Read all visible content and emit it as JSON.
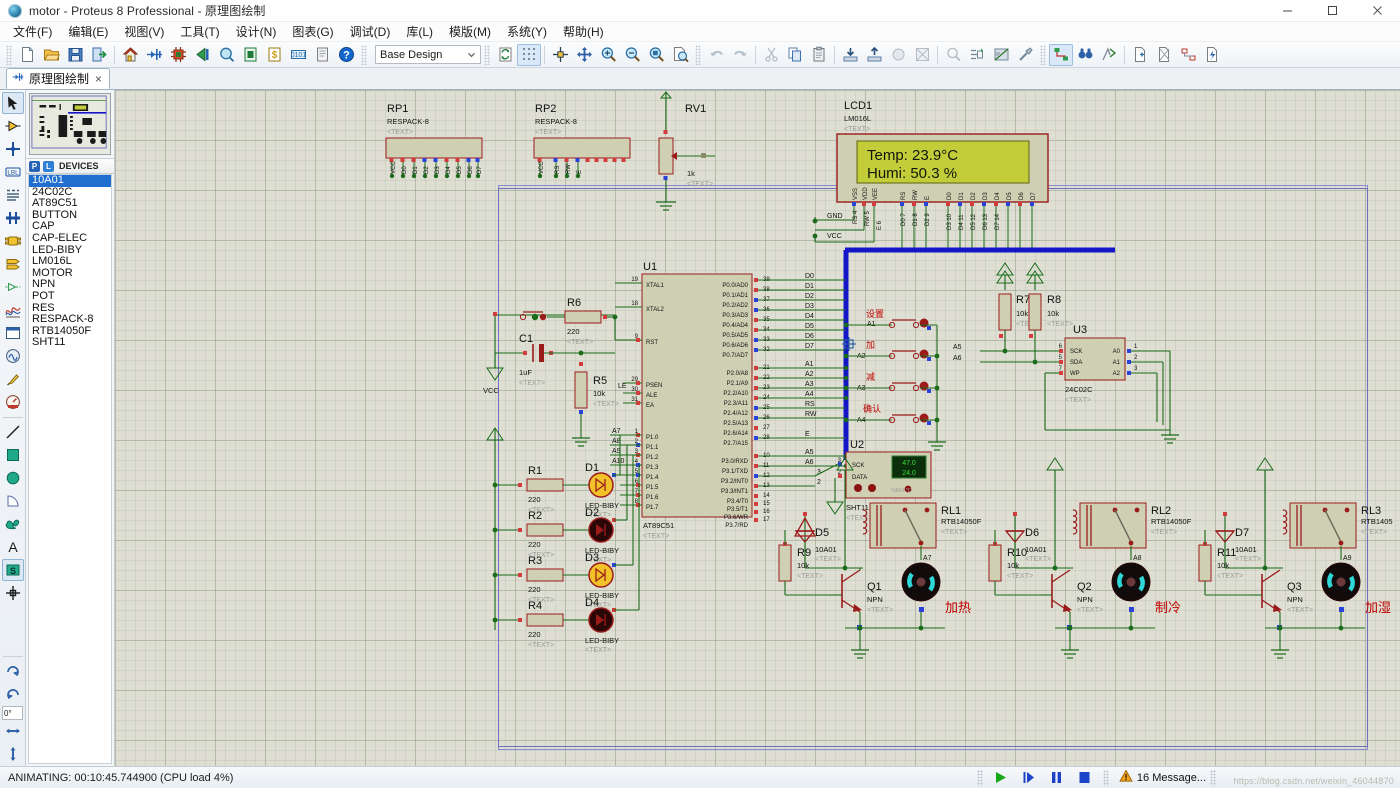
{
  "window": {
    "title": "motor - Proteus 8 Professional - 原理图绘制",
    "app_icon": "proteus-orb-icon",
    "minimize_label": "最小化",
    "maximize_label": "最大化",
    "close_label": "关闭"
  },
  "menubar": {
    "items": [
      {
        "name": "file",
        "label": "文件(F)"
      },
      {
        "name": "edit",
        "label": "编辑(E)"
      },
      {
        "name": "view",
        "label": "视图(V)"
      },
      {
        "name": "tools",
        "label": "工具(T)"
      },
      {
        "name": "design",
        "label": "设计(N)"
      },
      {
        "name": "graph",
        "label": "图表(G)"
      },
      {
        "name": "debug",
        "label": "调试(D)"
      },
      {
        "name": "library",
        "label": "库(L)"
      },
      {
        "name": "template",
        "label": "模版(M)"
      },
      {
        "name": "system",
        "label": "系统(Y)"
      },
      {
        "name": "help",
        "label": "帮助(H)"
      }
    ]
  },
  "toolbar": {
    "design_selector_value": "Base Design",
    "groups": [
      [
        "new-file-icon",
        "open-folder-icon",
        "save-icon",
        "export-icon"
      ],
      [
        "home-icon",
        "schematic-capture-icon",
        "pcb-layout-icon",
        "3d-viewer-icon",
        "design-explorer-icon",
        "bom-report-icon",
        "bill-of-materials-icon",
        "visual-designer-icon",
        "source-code-icon",
        "help-icon"
      ]
    ],
    "view_group": [
      "refresh-icon",
      "toggle-grid-icon",
      "origin-icon",
      "pan-icon",
      "zoom-in-icon",
      "zoom-out-icon",
      "zoom-area-icon",
      "zoom-sheet-icon"
    ],
    "edit_group": [
      "undo-icon",
      "redo-icon",
      "cut-icon",
      "copy-icon",
      "paste-icon",
      "block-copy-icon",
      "block-move-icon",
      "block-rotate-icon",
      "block-delete-icon"
    ],
    "tool_group": [
      "pick-device-icon",
      "make-device-icon",
      "packaging-tool-icon",
      "decompose-icon"
    ],
    "net_group": [
      "wire-autorouter-icon",
      "search-tag-icon",
      "property-assign-icon",
      "new-sheet-icon",
      "remove-sheet-icon",
      "exit-sheet-icon",
      "bom-icon",
      "electrical-rules-icon"
    ]
  },
  "document_tab": {
    "icon": "schematic-icon",
    "label": "原理图绘制",
    "close_label": "×"
  },
  "left_toolbar": {
    "items": [
      {
        "name": "selection-mode",
        "icon": "arrow-cursor-icon",
        "selected": true
      },
      {
        "name": "component-mode",
        "icon": "component-icon",
        "selected": false
      },
      {
        "name": "junction-dot-mode",
        "icon": "junction-dot-icon",
        "selected": false
      },
      {
        "name": "wire-label-mode",
        "icon": "label-icon",
        "selected": false
      },
      {
        "name": "text-script-mode",
        "icon": "text-script-icon",
        "selected": false
      },
      {
        "name": "bus-mode",
        "icon": "bus-icon",
        "selected": false
      },
      {
        "name": "subcircuit-mode",
        "icon": "subcircuit-icon",
        "selected": false
      },
      {
        "name": "terminal-mode",
        "icon": "terminal-icon",
        "selected": false
      },
      {
        "name": "device-pin-mode",
        "icon": "device-pin-icon",
        "selected": false
      },
      {
        "name": "graph-mode",
        "icon": "graph-icon",
        "selected": false
      },
      {
        "name": "tape-recorder-mode",
        "icon": "tape-recorder-icon",
        "selected": false
      },
      {
        "name": "generator-mode",
        "icon": "generator-icon",
        "selected": false
      },
      {
        "name": "voltage-probe-mode",
        "icon": "probe-icon",
        "selected": false
      },
      {
        "name": "virtual-instrument-mode",
        "icon": "instrument-icon",
        "selected": false
      },
      {
        "name": "2d-line-mode",
        "icon": "line-icon",
        "selected": false
      },
      {
        "name": "2d-box-mode",
        "icon": "box-icon",
        "selected": false
      },
      {
        "name": "2d-circle-mode",
        "icon": "circle-icon",
        "selected": false
      },
      {
        "name": "2d-arc-mode",
        "icon": "arc-icon",
        "selected": false
      },
      {
        "name": "2d-path-mode",
        "icon": "path-icon",
        "selected": false
      },
      {
        "name": "2d-text-mode",
        "icon": "text-icon",
        "selected": false
      },
      {
        "name": "symbol-mode",
        "icon": "symbol-icon",
        "selected": true
      },
      {
        "name": "marker-mode",
        "icon": "marker-icon",
        "selected": false
      }
    ],
    "rotate_cw": "rotate-clockwise-icon",
    "rotate_ccw": "rotate-counter-clockwise-icon",
    "rotation_value": "0°",
    "mirror_x": "mirror-horizontal-icon",
    "mirror_y": "mirror-vertical-icon"
  },
  "devices_panel": {
    "overview_label": "schematic-overview",
    "p_button": "P",
    "l_button": "L",
    "caption": "DEVICES",
    "items": [
      "10A01",
      "24C02C",
      "AT89C51",
      "BUTTON",
      "CAP",
      "CAP-ELEC",
      "LED-BIBY",
      "LM016L",
      "MOTOR",
      "NPN",
      "POT",
      "RES",
      "RESPACK-8",
      "RTB14050F",
      "SHT11"
    ],
    "selected_index": 0
  },
  "statusbar": {
    "message": "ANIMATING: 00:10:45.744900 (CPU load 4%)",
    "controls": [
      {
        "name": "play-button",
        "icon": "play-icon"
      },
      {
        "name": "step-button",
        "icon": "step-icon"
      },
      {
        "name": "pause-button",
        "icon": "pause-icon"
      },
      {
        "name": "stop-button",
        "icon": "stop-icon"
      }
    ],
    "warning_icon": "warning-triangle-icon",
    "messages_text": "16 Message...",
    "watermark": "https://blog.csdn.net/weixin_46044870"
  },
  "schematic": {
    "lcd": {
      "ref": "LCD1",
      "part": "LM016L",
      "text_tag": "<TEXT>",
      "line1": "Temp: 23.9°C",
      "line2": "Humi: 50.3 %",
      "screen_color": "#c3cd3a",
      "pins_top": [
        "VSS",
        "VDD",
        "VEE",
        "RS",
        "RW",
        "E",
        "D0",
        "D1",
        "D2",
        "D3",
        "D4",
        "D5",
        "D6",
        "D7"
      ],
      "pins_num": [
        "1",
        "2",
        "3",
        "4",
        "5",
        "6",
        "7",
        "8",
        "9",
        "10",
        "11",
        "12",
        "13",
        "14"
      ],
      "net_gnd": "GND",
      "net_vcc": "VCC"
    },
    "mcu": {
      "ref": "U1",
      "part": "AT89C51",
      "text_tag": "<TEXT>",
      "left_pins": [
        {
          "num": "19",
          "label": "XTAL1"
        },
        {
          "num": "18",
          "label": "XTAL2"
        },
        {
          "num": "9",
          "label": "RST"
        },
        {
          "num": "29",
          "label": "PSEN"
        },
        {
          "num": "30",
          "label": "ALE"
        },
        {
          "num": "31",
          "label": "EA"
        },
        {
          "num": "1",
          "label": "P1.0"
        },
        {
          "num": "2",
          "label": "P1.1"
        },
        {
          "num": "3",
          "label": "P1.2"
        },
        {
          "num": "4",
          "label": "P1.3"
        },
        {
          "num": "5",
          "label": "P1.4"
        },
        {
          "num": "6",
          "label": "P1.5"
        },
        {
          "num": "7",
          "label": "P1.6"
        },
        {
          "num": "8",
          "label": "P1.7"
        }
      ],
      "right_pins": [
        {
          "num": "39",
          "label": "P0.0/AD0",
          "net": "D0"
        },
        {
          "num": "38",
          "label": "P0.1/AD1",
          "net": "D1"
        },
        {
          "num": "37",
          "label": "P0.2/AD2",
          "net": "D2"
        },
        {
          "num": "36",
          "label": "P0.3/AD3",
          "net": "D3"
        },
        {
          "num": "35",
          "label": "P0.4/AD4",
          "net": "D4"
        },
        {
          "num": "34",
          "label": "P0.5/AD5",
          "net": "D5"
        },
        {
          "num": "33",
          "label": "P0.6/AD6",
          "net": "D6"
        },
        {
          "num": "32",
          "label": "P0.7/AD7",
          "net": "D7"
        },
        {
          "num": "21",
          "label": "P2.0/A8",
          "net": "A1"
        },
        {
          "num": "22",
          "label": "P2.1/A9",
          "net": "A2"
        },
        {
          "num": "23",
          "label": "P2.2/A10",
          "net": "A3"
        },
        {
          "num": "24",
          "label": "P2.3/A11",
          "net": "A4"
        },
        {
          "num": "25",
          "label": "P2.4/A12",
          "net": "RS"
        },
        {
          "num": "26",
          "label": "P2.5/A13",
          "net": "RW"
        },
        {
          "num": "27",
          "label": "P2.6/A14",
          "net": ""
        },
        {
          "num": "28",
          "label": "P2.7/A15",
          "net": "E"
        },
        {
          "num": "10",
          "label": "P3.0/RXD",
          "net": "A5"
        },
        {
          "num": "11",
          "label": "P3.1/TXD",
          "net": "A6"
        },
        {
          "num": "12",
          "label": "P3.2/INT0",
          "net": "3"
        },
        {
          "num": "13",
          "label": "P3.3/INT1",
          "net": "2"
        },
        {
          "num": "14",
          "label": "P3.4/T0",
          "net": ""
        },
        {
          "num": "15",
          "label": "P3.5/T1",
          "net": ""
        },
        {
          "num": "16",
          "label": "P3.6/WR",
          "net": ""
        },
        {
          "num": "17",
          "label": "P3.7/RD",
          "net": ""
        }
      ],
      "left_nets": [
        "A7",
        "A8",
        "A9",
        "A10",
        "",
        "",
        "",
        ""
      ],
      "le_net": "LE"
    },
    "respacks": [
      {
        "ref": "RP1",
        "part": "RESPACK-8",
        "text_tag": "<TEXT>",
        "pin_labels": [
          "VCC",
          "D0",
          "D1",
          "D2",
          "D3",
          "D4",
          "D5",
          "D6",
          "D7"
        ],
        "pin_nums": [
          "1",
          "2",
          "3",
          "4",
          "5",
          "6",
          "7",
          "8",
          "9"
        ]
      },
      {
        "ref": "RP2",
        "part": "RESPACK-8",
        "text_tag": "<TEXT>",
        "pin_labels": [
          "VCC",
          "RS",
          "RW",
          "E",
          "",
          "",
          "",
          "",
          ""
        ],
        "pin_nums": [
          "1",
          "2",
          "3",
          "4",
          "5",
          "6",
          "7",
          "8",
          "9"
        ]
      }
    ],
    "pot": {
      "ref": "RV1",
      "value": "1k",
      "text_tag": "<TEXT>"
    },
    "osc": {
      "cap": {
        "ref": "C1",
        "value": "1uF",
        "text_tag": "<TEXT>"
      },
      "r6": {
        "ref": "R6",
        "value": "220",
        "text_tag": "<TEXT>"
      },
      "r5": {
        "ref": "R5",
        "value": "10k",
        "text_tag": "<TEXT>"
      },
      "vcc_label": "VCC"
    },
    "leds": [
      {
        "res_ref": "R1",
        "res_value": "220",
        "led_ref": "D1",
        "led_part": "LED-BIBY",
        "text_tag": "<TEXT>",
        "lit": true
      },
      {
        "res_ref": "R2",
        "res_value": "220",
        "led_ref": "D2",
        "led_part": "LED-BIBY",
        "text_tag": "<TEXT>",
        "lit": false
      },
      {
        "res_ref": "R3",
        "res_value": "220",
        "led_ref": "D3",
        "led_part": "LED-BIBY",
        "text_tag": "<TEXT>",
        "lit": true
      },
      {
        "res_ref": "R4",
        "res_value": "220",
        "led_ref": "D4",
        "led_part": "LED-BIBY",
        "text_tag": "<TEXT>",
        "lit": false
      }
    ],
    "buttons": [
      {
        "label": "设置",
        "net": "A1"
      },
      {
        "label": "加",
        "net": "A2"
      },
      {
        "label": "减",
        "net": "A3"
      },
      {
        "label": "确认",
        "net": "A4"
      }
    ],
    "pullups": [
      {
        "ref": "R7",
        "value": "10k",
        "text_tag": "<TEXT>"
      },
      {
        "ref": "R8",
        "value": "10k",
        "text_tag": "<TEXT>"
      }
    ],
    "eeprom": {
      "ref": "U3",
      "part": "24C02C",
      "text_tag": "<TEXT>",
      "left_pins": [
        {
          "num": "6",
          "label": "SCK",
          "net": "A5"
        },
        {
          "num": "5",
          "label": "SDA",
          "net": "A6"
        },
        {
          "num": "7",
          "label": "WP",
          "net": ""
        }
      ],
      "right_pins": [
        {
          "num": "1",
          "label": "A0"
        },
        {
          "num": "2",
          "label": "A1"
        },
        {
          "num": "3",
          "label": "A2"
        }
      ]
    },
    "sensor": {
      "ref": "U2",
      "part": "SHT11",
      "text_tag": "<TEXT>",
      "pins": [
        {
          "num": "3",
          "label": "SCK"
        },
        {
          "num": "2",
          "label": "DATA"
        }
      ],
      "display_humidity": "47.0",
      "display_temperature": "24.0",
      "display_unit": "%RH  ℃"
    },
    "drivers": [
      {
        "diode_ref": "D5",
        "diode_part": "10A01",
        "res_ref": "R9",
        "res_value": "10k",
        "tr_ref": "Q1",
        "tr_part": "NPN",
        "relay_ref": "RL1",
        "relay_part": "RTB14050F",
        "motor_net": "A7",
        "motor_label": "加热",
        "text_tag": "<TEXT>"
      },
      {
        "diode_ref": "D6",
        "diode_part": "10A01",
        "res_ref": "R10",
        "res_value": "10k",
        "tr_ref": "Q2",
        "tr_part": "NPN",
        "relay_ref": "RL2",
        "relay_part": "RTB14050F",
        "motor_net": "A8",
        "motor_label": "制冷",
        "text_tag": "<TEXT>"
      },
      {
        "diode_ref": "D7",
        "diode_part": "10A01",
        "res_ref": "R11",
        "res_value": "10k",
        "tr_ref": "Q3",
        "tr_part": "NPN",
        "relay_ref": "RL3",
        "relay_part": "RTB1405",
        "motor_net": "A9",
        "motor_label": "加湿",
        "text_tag": "<TEXT>"
      }
    ]
  }
}
